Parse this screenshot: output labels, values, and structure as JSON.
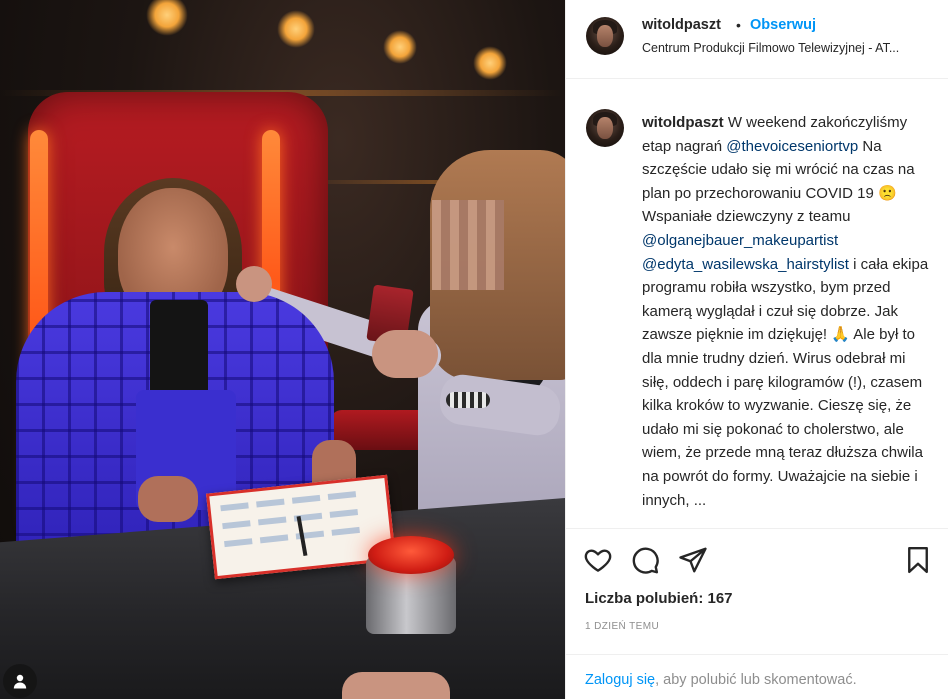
{
  "post": {
    "username": "witoldpaszt",
    "dot": "•",
    "follow_label": "Obserwuj",
    "location": "Centrum Produkcji Filmowo Telewizyjnej - AT..."
  },
  "caption": {
    "username": "witoldpaszt",
    "part1": " W weekend zakończyliśmy etap nagrań ",
    "mention1": "@thevoiceseniortvp",
    "part2": " Na szczęście udało się mi wrócić na czas na plan po przechorowaniu COVID 19 🙁 Wspaniałe dziewczyny z teamu ",
    "mention2": "@olganejbauer_makeupartist",
    "part3": " ",
    "mention3": "@edyta_wasilewska_hairstylist",
    "part4": " i cała ekipa programu robiła wszystko, bym przed kamerą wyglądał i czuł się dobrze. Jak zawsze pięknie im dziękuję! 🙏 Ale był to dla mnie trudny dzień. Wirus odebrał mi siłę, oddech i parę kilogramów (!), czasem kilka kroków to wyzwanie. Cieszę się, że udało mi się pokonać to cholerstwo, ale wiem, że przede mną teraz dłuższa chwila na powrót do formy. Uważajcie na siebie i innych, ..."
  },
  "actions": {
    "icons": [
      "heart-icon",
      "comment-icon",
      "share-icon",
      "bookmark-icon"
    ],
    "likes_label": "Liczba polubień: 167",
    "time_label": "1 DZIEŃ TEMU"
  },
  "login": {
    "link": "Zaloguj się",
    "rest": ", aby polubić lub skomentować."
  },
  "colors": {
    "link_blue": "#0095f6",
    "mention_blue": "#00376b",
    "text": "#262626",
    "muted": "#8e8e8e"
  }
}
